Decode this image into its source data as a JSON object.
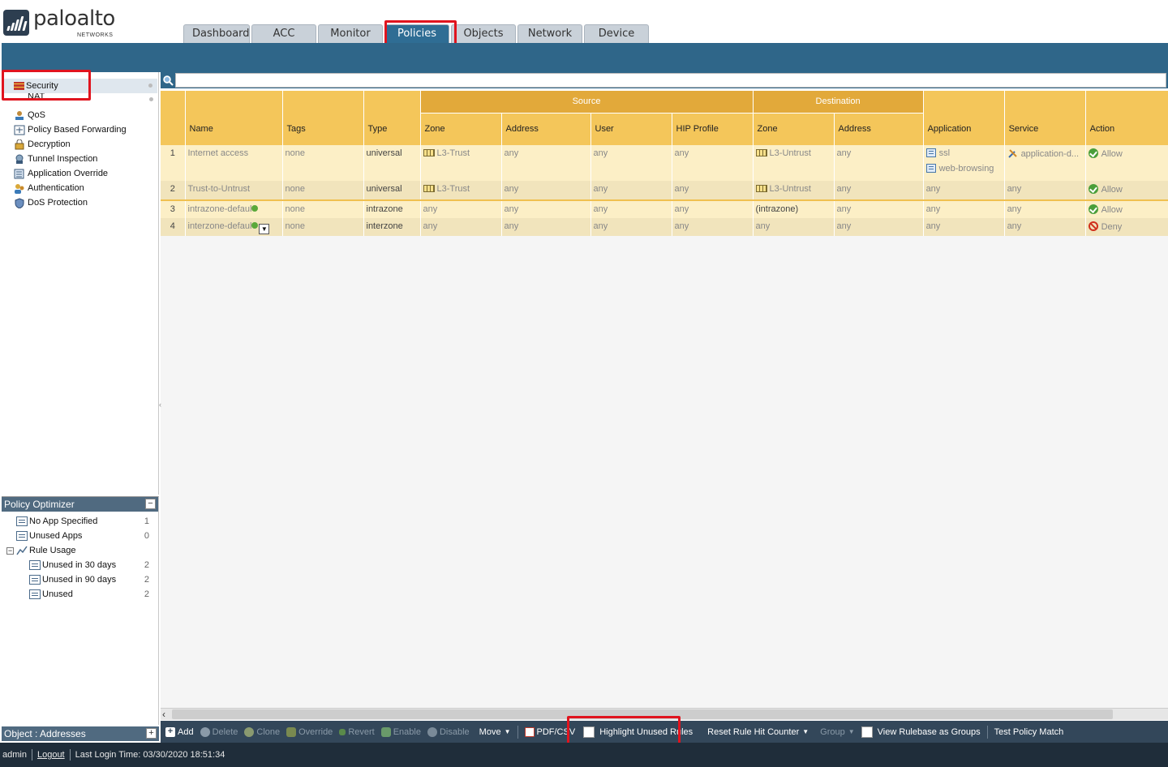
{
  "brand": {
    "word": "paloalto",
    "sub": "NETWORKS"
  },
  "tabs": [
    "Dashboard",
    "ACC",
    "Monitor",
    "Policies",
    "Objects",
    "Network",
    "Device"
  ],
  "active_tab": "Policies",
  "policy_nav": {
    "items": [
      {
        "label": "Security",
        "icon": "security-wall-icon"
      },
      {
        "label": "NAT",
        "icon": "nat-icon"
      },
      {
        "label": "QoS",
        "icon": "qos-icon"
      },
      {
        "label": "Policy Based Forwarding",
        "icon": "pbf-icon"
      },
      {
        "label": "Decryption",
        "icon": "lock-icon"
      },
      {
        "label": "Tunnel Inspection",
        "icon": "tunnel-icon"
      },
      {
        "label": "Application Override",
        "icon": "app-override-icon"
      },
      {
        "label": "Authentication",
        "icon": "users-icon"
      },
      {
        "label": "DoS Protection",
        "icon": "dos-icon"
      }
    ]
  },
  "optimizer": {
    "title": "Policy Optimizer",
    "items": [
      {
        "label": "No App Specified",
        "count": "1"
      },
      {
        "label": "Unused Apps",
        "count": "0"
      },
      {
        "label": "Rule Usage",
        "count": ""
      },
      {
        "label": "Unused in 30 days",
        "count": "2"
      },
      {
        "label": "Unused in 90 days",
        "count": "2"
      },
      {
        "label": "Unused",
        "count": "2"
      }
    ]
  },
  "object_bar": {
    "label": "Object : Addresses"
  },
  "grid": {
    "groups": {
      "source": "Source",
      "destination": "Destination"
    },
    "columns": {
      "name": "Name",
      "tags": "Tags",
      "type": "Type",
      "src_zone": "Zone",
      "src_address": "Address",
      "user": "User",
      "hip": "HIP Profile",
      "dst_zone": "Zone",
      "dst_address": "Address",
      "application": "Application",
      "service": "Service",
      "action": "Action"
    },
    "rows": [
      {
        "num": "1",
        "name": "Internet access",
        "tags": "none",
        "type": "universal",
        "src_zone": "L3-Trust",
        "src_address": "any",
        "user": "any",
        "hip": "any",
        "dst_zone": "L3-Untrust",
        "dst_address": "any",
        "app1": "ssl",
        "app2": "web-browsing",
        "service": "application-d...",
        "action": "Allow"
      },
      {
        "num": "2",
        "name": "Trust-to-Untrust",
        "tags": "none",
        "type": "universal",
        "src_zone": "L3-Trust",
        "src_address": "any",
        "user": "any",
        "hip": "any",
        "dst_zone": "L3-Untrust",
        "dst_address": "any",
        "app1": "any",
        "service": "any",
        "action": "Allow"
      },
      {
        "num": "3",
        "name": "intrazone-defaul",
        "tags": "none",
        "type": "intrazone",
        "src_zone": "any",
        "src_address": "any",
        "user": "any",
        "hip": "any",
        "dst_zone": "(intrazone)",
        "dst_address": "any",
        "app1": "any",
        "service": "any",
        "action": "Allow"
      },
      {
        "num": "4",
        "name": "interzone-defaul",
        "tags": "none",
        "type": "interzone",
        "src_zone": "any",
        "src_address": "any",
        "user": "any",
        "hip": "any",
        "dst_zone": "any",
        "dst_address": "any",
        "app1": "any",
        "service": "any",
        "action": "Deny"
      }
    ]
  },
  "toolbar": {
    "add": "Add",
    "delete": "Delete",
    "clone": "Clone",
    "override": "Override",
    "revert": "Revert",
    "enable": "Enable",
    "disable": "Disable",
    "move": "Move",
    "pdfcsv": "PDF/CSV",
    "highlight": "Highlight Unused Rules",
    "reset": "Reset Rule Hit Counter",
    "group": "Group",
    "view_groups": "View Rulebase as Groups",
    "test": "Test Policy Match"
  },
  "status": {
    "user": "admin",
    "logout": "Logout",
    "last_login": "Last Login Time: 03/30/2020 18:51:34"
  },
  "colors": {
    "header_blue": "#2f6689",
    "active_tab": "#2f6d94",
    "grid_header": "#f4c65a",
    "group_header": "#e2a93a",
    "highlight_red": "#e0141e",
    "allow_green": "#4a9e3a",
    "deny_red": "#d0301c"
  }
}
